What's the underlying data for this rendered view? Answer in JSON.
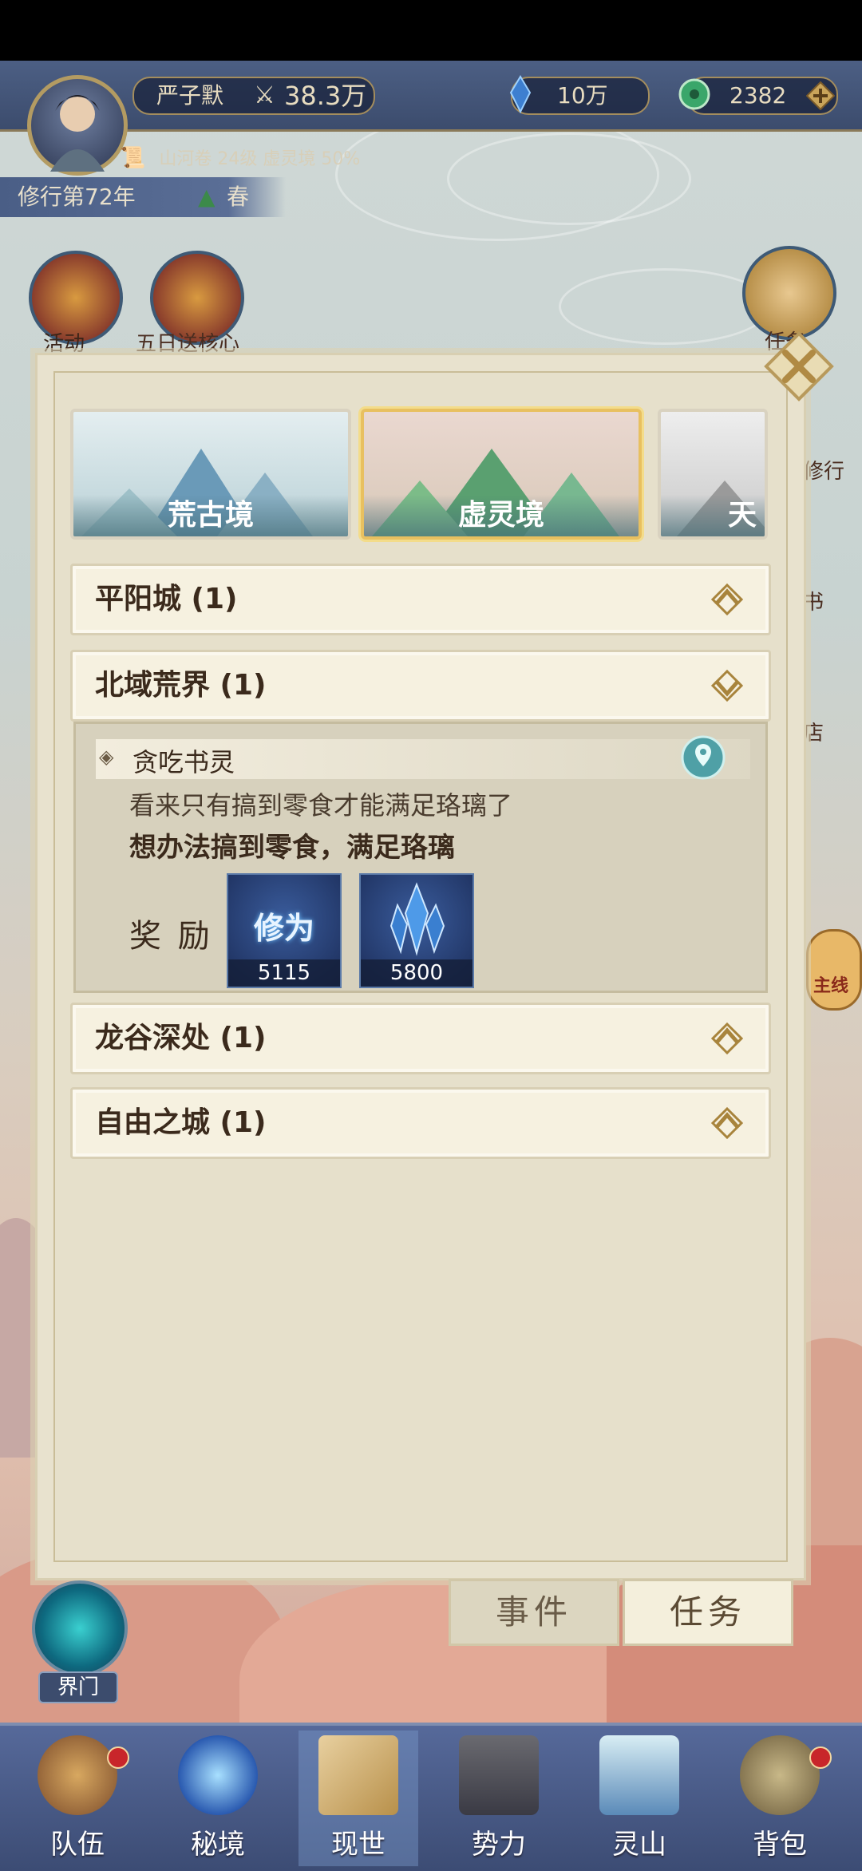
{
  "header": {
    "player_name": "严子默",
    "power": "38.3万",
    "currency1": "10万",
    "currency2": "2382",
    "sub_line": "山河卷 24级 虚灵境 50%",
    "year": "修行第72年",
    "season": "春"
  },
  "top_icons": {
    "activity": "活动",
    "five_day": "五日送核心",
    "task": "任务",
    "practice": "修行",
    "book": "书",
    "shop": "店",
    "mainline": "主线"
  },
  "realm_tabs": [
    {
      "label": "荒古境"
    },
    {
      "label": "虚灵境"
    },
    {
      "label": "天"
    }
  ],
  "sections": [
    {
      "title": "平阳城 (1)"
    },
    {
      "title": "北域荒界 (1)"
    },
    {
      "title": "龙谷深处 (1)"
    },
    {
      "title": "自由之城 (1)"
    }
  ],
  "task": {
    "name": "贪吃书灵",
    "desc": "看来只有搞到零食才能满足珞璃了",
    "goal": "想办法搞到零食，满足珞璃",
    "reward_label": "奖 励",
    "rewards": [
      {
        "name": "修为",
        "count": "5115"
      },
      {
        "name": "crystal",
        "count": "5800"
      }
    ]
  },
  "panel_buttons": {
    "events": "事件",
    "tasks": "任务"
  },
  "gate_label": "界门",
  "bottom_nav": [
    {
      "label": "队伍"
    },
    {
      "label": "秘境"
    },
    {
      "label": "现世"
    },
    {
      "label": "势力"
    },
    {
      "label": "灵山"
    },
    {
      "label": "背包"
    }
  ]
}
